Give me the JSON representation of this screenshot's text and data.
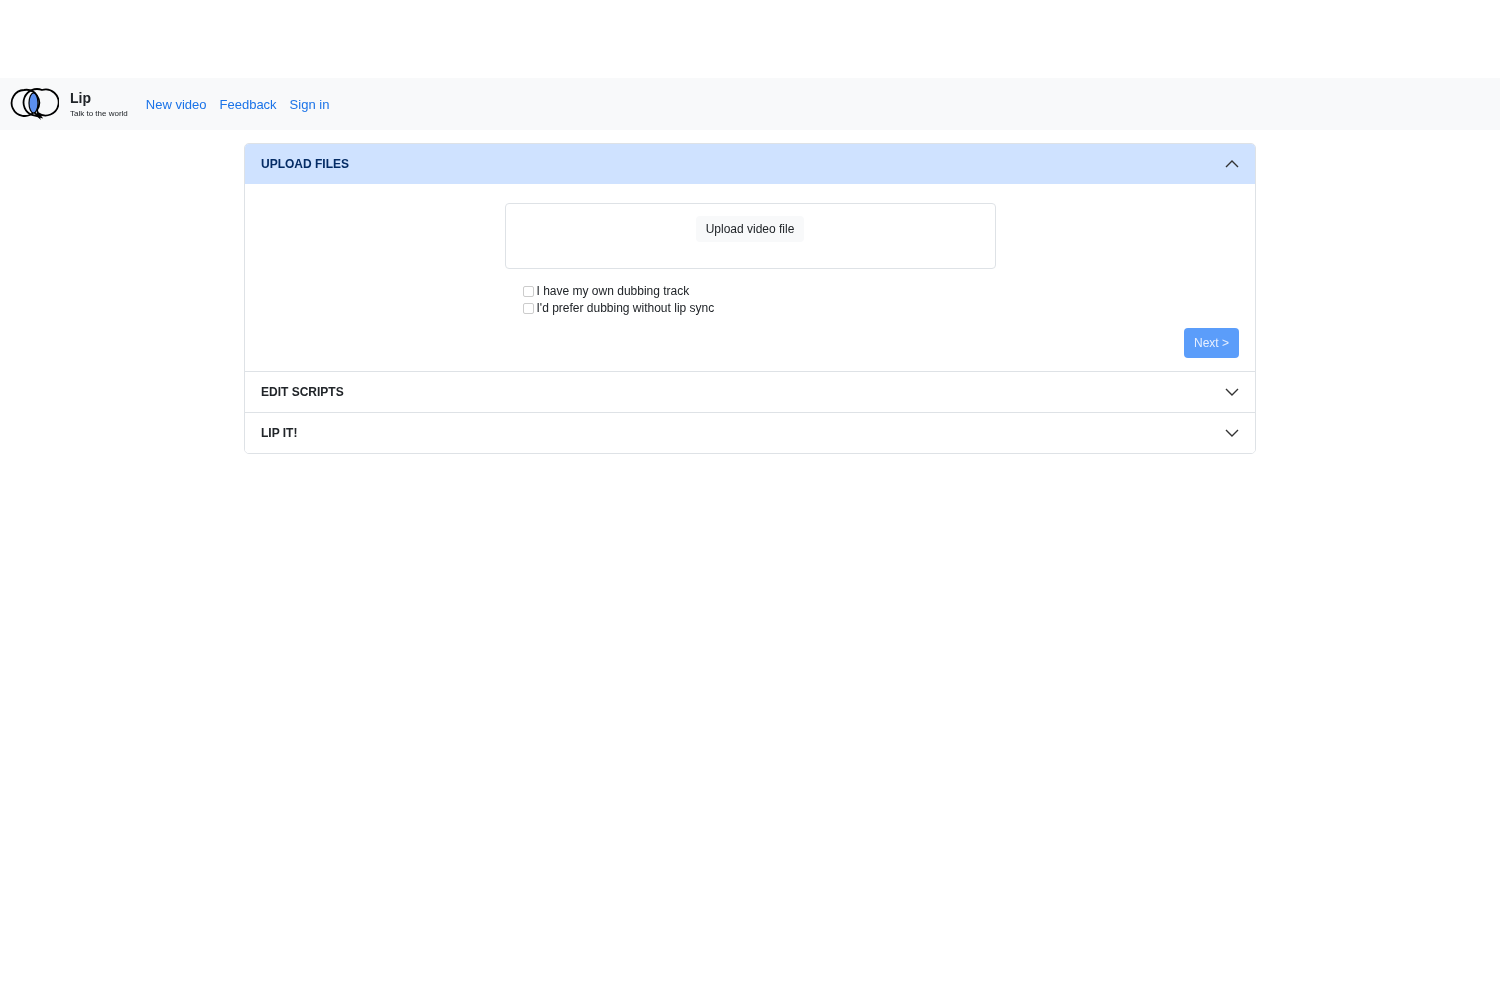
{
  "navbar": {
    "brand": "Lip",
    "tagline": "Talk to the world",
    "links": [
      "New video",
      "Feedback",
      "Sign in"
    ]
  },
  "accordion": [
    {
      "title": "UPLOAD FILES",
      "expanded": true,
      "upload_button": "Upload video file",
      "options": [
        {
          "label": "I have my own dubbing track",
          "checked": false
        },
        {
          "label": "I'd prefer dubbing without lip sync",
          "checked": false
        }
      ],
      "next_button": {
        "label": "Next >",
        "disabled": true
      }
    },
    {
      "title": "EDIT SCRIPTS",
      "expanded": false
    },
    {
      "title": "LIP IT!",
      "expanded": false
    }
  ]
}
